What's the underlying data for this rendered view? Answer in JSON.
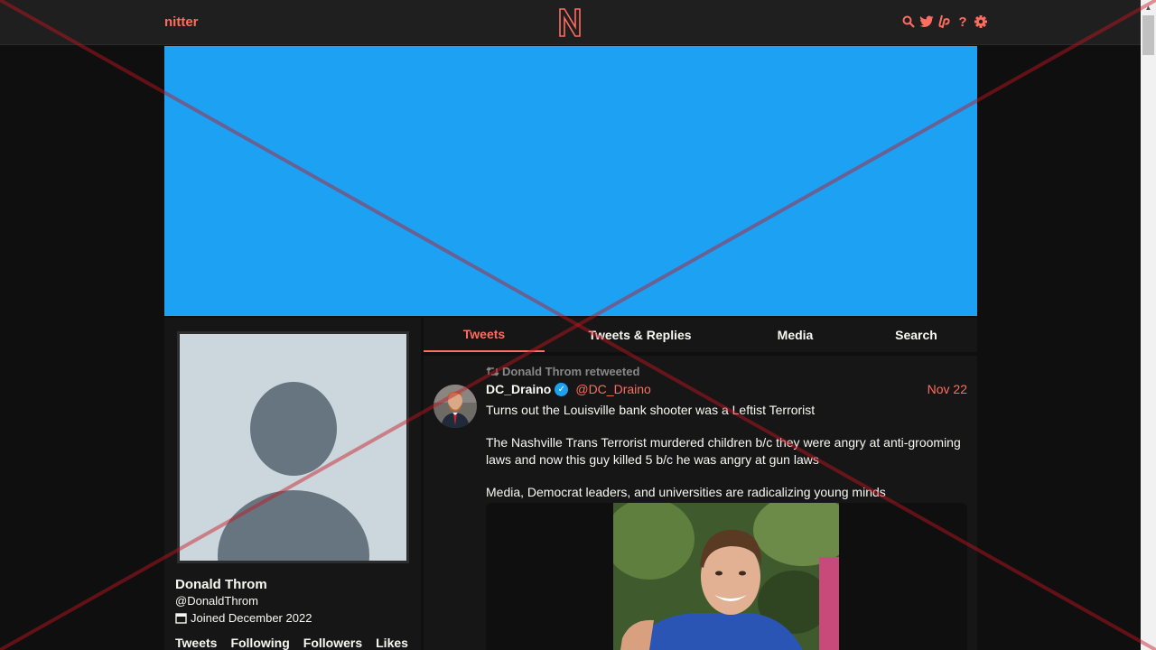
{
  "nav": {
    "brand": "nitter",
    "logo_letter": "N",
    "icons": [
      "search-icon",
      "twitter-icon",
      "liberapay-icon",
      "help-icon",
      "gear-icon"
    ],
    "help_glyph": "?",
    "accent": "#ff6c60"
  },
  "banner": {
    "color": "#1da1f2"
  },
  "profile": {
    "fullname": "Donald Throm",
    "username": "@DonaldThrom",
    "joined": "Joined December 2022",
    "stats": [
      "Tweets",
      "Following",
      "Followers",
      "Likes"
    ]
  },
  "tabs": [
    {
      "label": "Tweets",
      "active": true
    },
    {
      "label": "Tweets & Replies",
      "active": false
    },
    {
      "label": "Media",
      "active": false
    },
    {
      "label": "Search",
      "active": false
    }
  ],
  "tweet": {
    "retweet_label": "Donald Throm retweeted",
    "name": "DC_Draino",
    "verified": true,
    "handle": "@DC_Draino",
    "date": "Nov 22",
    "paragraphs": [
      "Turns out the Louisville bank shooter was a Leftist Terrorist",
      "The Nashville Trans Terrorist murdered children b/c they were angry at anti-grooming laws and now this guy killed 5 b/c he was angry at gun laws",
      "Media, Democrat leaders, and universities are radicalizing young minds"
    ]
  },
  "overlay": {
    "cross_color": "#c8141e"
  }
}
